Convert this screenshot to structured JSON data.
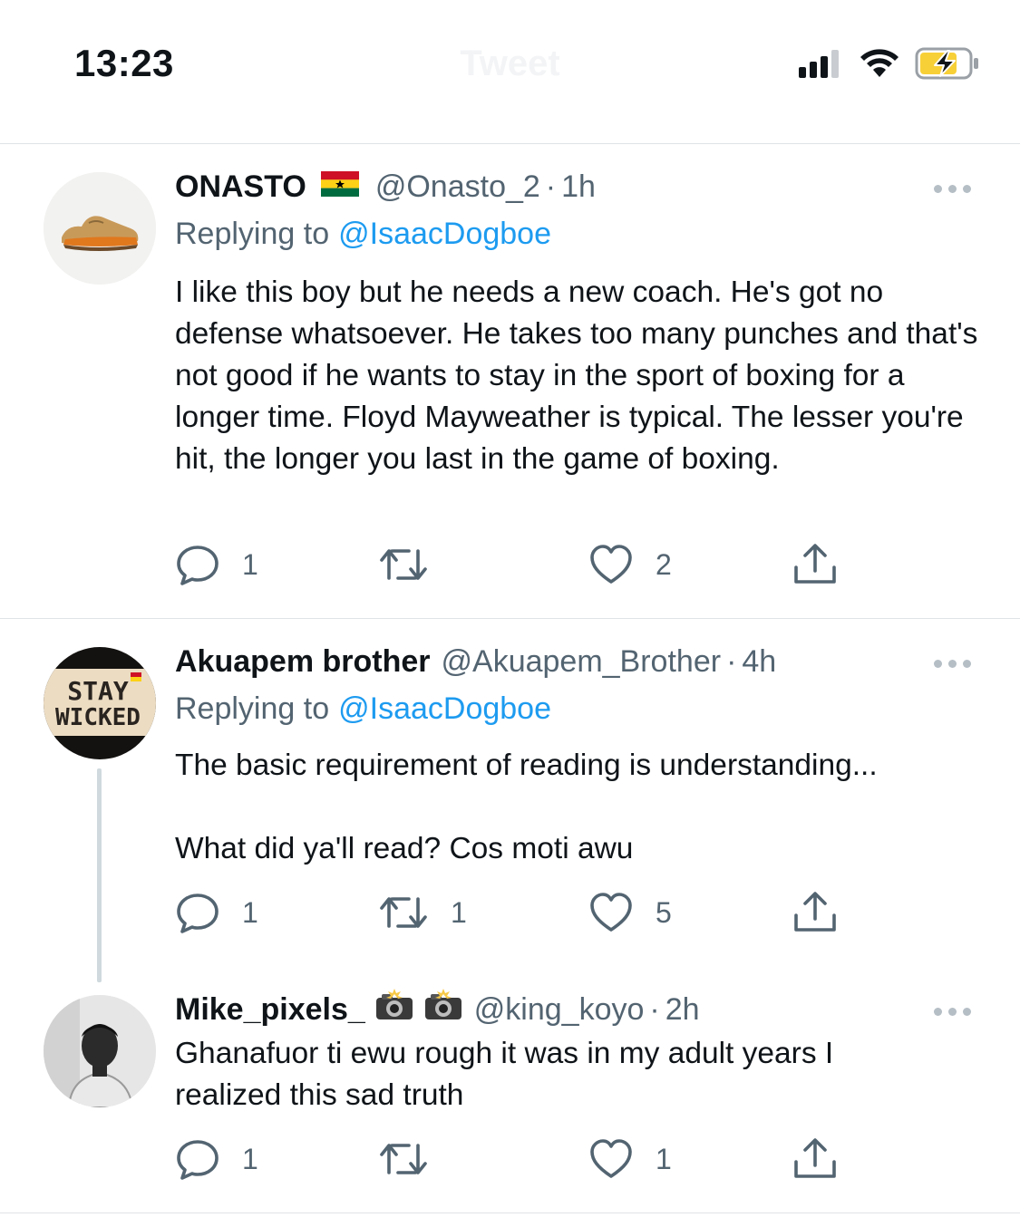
{
  "status_bar": {
    "time": "13:23",
    "signal_icon": "cellular-signal-icon",
    "wifi_icon": "wifi-icon",
    "battery_icon": "battery-charging-icon"
  },
  "header": {
    "title": "Tweet"
  },
  "colors": {
    "link": "#1d9bf0",
    "secondary_text": "#536471",
    "icon_gray": "#536471",
    "divider": "#dfe3e6",
    "battery_fill": "#f7d038"
  },
  "tweets": [
    {
      "name": "ONASTO",
      "name_emoji": "ghana-flag",
      "handle": "@Onasto_2",
      "separator": "·",
      "time": "1h",
      "replying_prefix": "Replying to",
      "replying_to": "@IsaacDogboe",
      "text": "I like this boy but he needs a new coach. He's got no defense whatsoever. He takes too many punches and that's not good if he wants to stay in the sport of boxing for a longer time. Floyd Mayweather is typical. The lesser you're hit, the longer you last in the game of boxing.",
      "replies": "1",
      "retweets": "",
      "likes": "2"
    },
    {
      "name": "Akuapem brother",
      "handle": "@Akuapem_Brother",
      "separator": "·",
      "time": "4h",
      "replying_prefix": "Replying to",
      "replying_to": "@IsaacDogboe",
      "avatar_text_line1": "STAY",
      "avatar_text_line2": "WICKED",
      "text": "The basic requirement of reading is understanding...\n\nWhat did ya'll read? Cos moti awu",
      "replies": "1",
      "retweets": "1",
      "likes": "5"
    },
    {
      "name": "Mike_pixels_",
      "name_emoji": "camera-with-flash",
      "handle": "@king_koyo",
      "separator": "·",
      "time": "2h",
      "text": "Ghanafuor ti ewu rough it was in my adult years I realized this sad truth",
      "replies": "1",
      "retweets": "",
      "likes": "1"
    }
  ]
}
